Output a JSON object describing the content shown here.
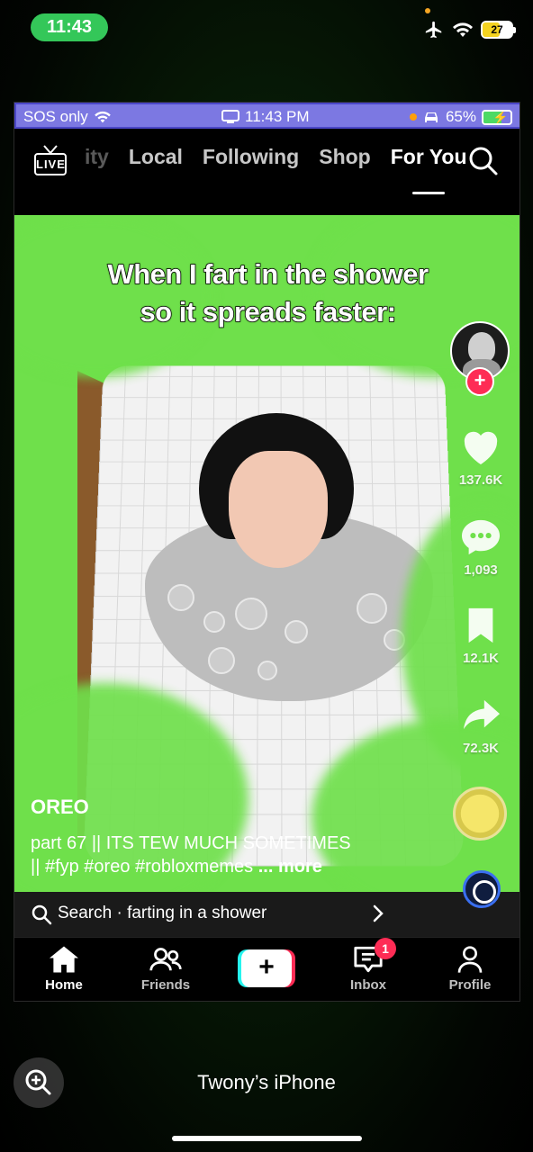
{
  "host_status": {
    "time": "11:43",
    "battery": "27"
  },
  "inner_status": {
    "carrier": "SOS only",
    "time": "11:43 PM",
    "battery": "65%"
  },
  "topnav": {
    "tabs": [
      {
        "label": "ity"
      },
      {
        "label": "Local"
      },
      {
        "label": "Following"
      },
      {
        "label": "Shop"
      },
      {
        "label": "For You"
      }
    ],
    "active_tab": "For You",
    "live_label": "LIVE"
  },
  "video": {
    "overlay_text_line1": "When I fart in the shower",
    "overlay_text_line2": "so it spreads faster:",
    "author": "OREO",
    "description_line1": "part 67 || ITS TEW MUCH SOMETIMES",
    "description_line2": "|| #fyp #oreo #robloxmemes",
    "more_label": "... more"
  },
  "actions": {
    "likes": "137.6K",
    "comments": "1,093",
    "saves": "12.1K",
    "shares": "72.3K"
  },
  "search_bar": {
    "text": "Search · farting in a shower"
  },
  "bottomnav": {
    "home": "Home",
    "friends": "Friends",
    "inbox": "Inbox",
    "inbox_badge": "1",
    "profile": "Profile"
  },
  "host_bottom": {
    "device_name": "Twony’s iPhone"
  },
  "colors": {
    "accent": "#fe2c55",
    "video_bg": "#6fe04b",
    "status_bar": "#7c78e2"
  }
}
